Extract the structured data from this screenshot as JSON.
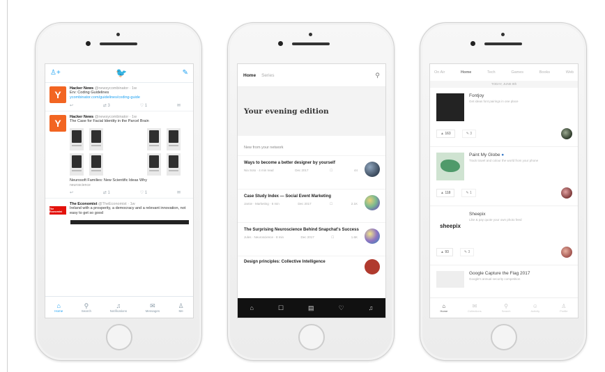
{
  "twitter": {
    "tweets": [
      {
        "author": "Hacker News",
        "handle": "@newsycombinator · 1w",
        "text": "Erv: Coding Guidelines",
        "link": "ycombinator.com/guidelines/coding-guide",
        "avatar_letter": "Y",
        "avatar_color": "#f26522",
        "actions": [
          "↩",
          "⇄ 3",
          "♡ 1",
          "✉"
        ]
      },
      {
        "author": "Hacker News",
        "handle": "@newsycombinator · 1w",
        "text": "The Case for Facial Identity in the Parcel Brain",
        "caption": "Neurosoft Families: New Scientific Ideas Why",
        "meta": "neuroscience",
        "avatar_letter": "Y",
        "avatar_color": "#f26522",
        "actions": [
          "↩",
          "⇄ 1",
          "♡ 1",
          "✉"
        ]
      },
      {
        "author": "The Economist",
        "handle": "@TheEconomist · 1w",
        "text": "Ireland with a prosperity, a democracy and a relevant innovation, not easy to get so good",
        "logo_text": "The Economist",
        "logo_color": "#e3120b"
      }
    ],
    "tabs": [
      {
        "icon": "⌂",
        "label": "Home"
      },
      {
        "icon": "⚲",
        "label": "Search"
      },
      {
        "icon": "♫",
        "label": "Notifications"
      },
      {
        "icon": "✉",
        "label": "Messages"
      },
      {
        "icon": "♙",
        "label": "Me"
      }
    ]
  },
  "medium": {
    "tabs": [
      "Home",
      "Series"
    ],
    "edition_title": "Your evening edition",
    "section_title": "New from your network",
    "articles": [
      {
        "title": "Ways to become a better designer by yourself",
        "author": "Nia Soto · 4 min read",
        "time": "Dec 2017",
        "claps": "44",
        "thumb": "#3b4a5c"
      },
      {
        "title": "Case Study Index — Social Event Marketing",
        "author": "Jamie · Marketing · 6 min",
        "time": "Dec 2017",
        "claps": "2.1K",
        "thumb": "#7bb98f"
      },
      {
        "title": "The Surprising Neuroscience Behind Snapchat's Success",
        "author": "Jules · Neuroscience · 8 min",
        "time": "Dec 2017",
        "claps": "1.6K",
        "thumb": "#8e74c2"
      },
      {
        "title": "Design principles: Collective Intelligence",
        "author": "",
        "time": "",
        "claps": "",
        "thumb": "#b03a2e"
      }
    ],
    "tabbar_icons": [
      "⌂",
      "☐",
      "▤",
      "♡",
      "♫"
    ]
  },
  "producthunt": {
    "tabs": [
      "On Air",
      "Home",
      "Tech",
      "Games",
      "Books",
      "Web"
    ],
    "active_tab": "Home",
    "date_label": "TODAY, JUNE 8th",
    "items": [
      {
        "name": "Fontjoy",
        "desc": "Get ideas font pairings in one place",
        "votes": "▲ 163",
        "comments": "✎ 3",
        "thumb": "#232323",
        "maker": "#2d3a2a"
      },
      {
        "name": "Paint My Globe",
        "desc": "Track travel and colour the world from your phone",
        "votes": "▲ 118",
        "comments": "✎ 1",
        "thumb": "#cfe3d1",
        "maker": "#7d3a3a"
      },
      {
        "name": "Sheepix",
        "desc": "Like & pay quote your own photo feed",
        "logo_text": "sheepix",
        "votes": "▲ 93",
        "comments": "✎ 3",
        "thumb": "#ffffff",
        "maker": "#a0524d"
      },
      {
        "name": "Google Capture the Flag 2017",
        "desc": "Google's annual security competition",
        "thumb": "#eeeeee"
      }
    ],
    "tabbar": [
      {
        "icon": "⌂",
        "label": "Home"
      },
      {
        "icon": "✉",
        "label": "Collections"
      },
      {
        "icon": "⚲",
        "label": "Search"
      },
      {
        "icon": "☺",
        "label": "Activity"
      },
      {
        "icon": "♙",
        "label": "Profile"
      }
    ]
  }
}
